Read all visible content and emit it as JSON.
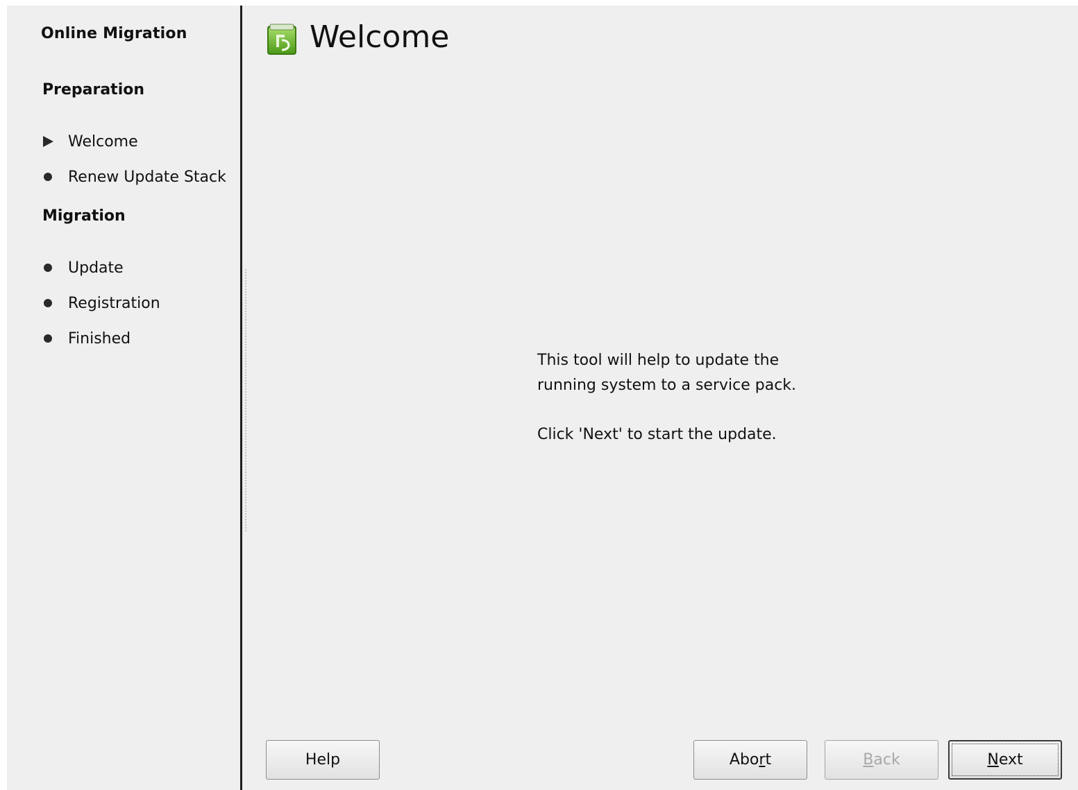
{
  "sidebar": {
    "app_title": "Online Migration",
    "sections": [
      {
        "title": "Preparation",
        "steps": [
          {
            "label": "Welcome",
            "state": "current"
          },
          {
            "label": "Renew Update Stack",
            "state": "pending"
          }
        ]
      },
      {
        "title": "Migration",
        "steps": [
          {
            "label": "Update",
            "state": "pending"
          },
          {
            "label": "Registration",
            "state": "pending"
          },
          {
            "label": "Finished",
            "state": "pending"
          }
        ]
      }
    ]
  },
  "header": {
    "title": "Welcome",
    "icon": "yast-update-icon"
  },
  "content": {
    "line1": "This tool will help to update the",
    "line2": "running system to a service pack.",
    "line3": "Click 'Next' to start the update."
  },
  "buttons": {
    "help": {
      "label": "Help",
      "enabled": true
    },
    "abort": {
      "before": "Abo",
      "mnemonic": "r",
      "after": "t",
      "enabled": true
    },
    "back": {
      "before": "",
      "mnemonic": "B",
      "after": "ack",
      "enabled": false
    },
    "next": {
      "before": "",
      "mnemonic": "N",
      "after": "ext",
      "enabled": true,
      "default": true
    }
  },
  "colors": {
    "window_bg": "#efefef",
    "divider": "#1e1e1e",
    "icon_green": "#6dbb2a",
    "disabled_text": "#a8a8a8"
  }
}
